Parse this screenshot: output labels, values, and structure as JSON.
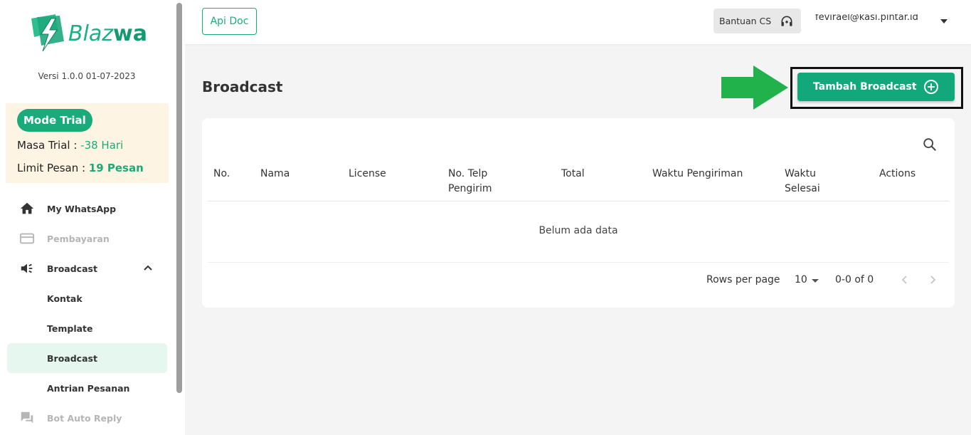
{
  "brand": {
    "name_light": "Blaz",
    "name_bold": "wa",
    "version": "Versi 1.0.0 01-07-2023"
  },
  "trial": {
    "badge": "Mode Trial",
    "period_label": "Masa Trial : ",
    "period_value": "-38 Hari",
    "limit_label": "Limit Pesan : ",
    "limit_value": "19 Pesan"
  },
  "sidebar": {
    "items": [
      {
        "label": "My WhatsApp",
        "icon": "home-icon"
      },
      {
        "label": "Pembayaran",
        "icon": "credit-card-icon"
      },
      {
        "label": "Broadcast",
        "icon": "megaphone-icon"
      },
      {
        "label": "Kontak"
      },
      {
        "label": "Template"
      },
      {
        "label": "Broadcast"
      },
      {
        "label": "Antrian Pesanan"
      },
      {
        "label": "Bot Auto Reply",
        "icon": "chat-bot-icon"
      }
    ]
  },
  "topbar": {
    "api_doc": "Api Doc",
    "support": "Bantuan CS",
    "user_email": "fevirael@kasi.pintar.id"
  },
  "main": {
    "title": "Broadcast",
    "add_button": "Tambah Broadcast",
    "table": {
      "columns": [
        "No.",
        "Nama",
        "License",
        "No. Telp Pengirim",
        "Total",
        "Waktu Pengiriman",
        "Waktu Selesai",
        "Actions"
      ],
      "empty_text": "Belum ada data",
      "rows_per_page_label": "Rows per page",
      "rows_per_page_value": "10",
      "range": "0-0 of 0"
    }
  },
  "colors": {
    "accent": "#1bab7b",
    "button": "#12a87c",
    "trial_bg": "#fdf4e3"
  }
}
